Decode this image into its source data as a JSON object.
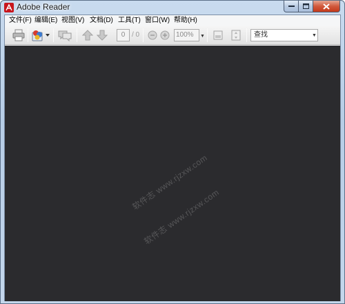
{
  "window": {
    "title": "Adobe Reader",
    "app_icon": "adobe-reader-icon"
  },
  "menu": [
    {
      "label": "文件(F)"
    },
    {
      "label": "编辑(E)"
    },
    {
      "label": "视图(V)"
    },
    {
      "label": "文档(D)"
    },
    {
      "label": "工具(T)"
    },
    {
      "label": "窗口(W)"
    },
    {
      "label": "帮助(H)"
    }
  ],
  "toolbar": {
    "page_current": "0",
    "page_total": "/ 0",
    "zoom": "100%",
    "search_placeholder": "查找"
  },
  "document": {
    "watermark_1": "软件志 www.rjzxw.com",
    "watermark_2": "软件志 www.rjzxw.com"
  },
  "colors": {
    "document_background": "#2b2b2e",
    "title_bar": "#b7cde6",
    "close_button": "#c4391a"
  }
}
